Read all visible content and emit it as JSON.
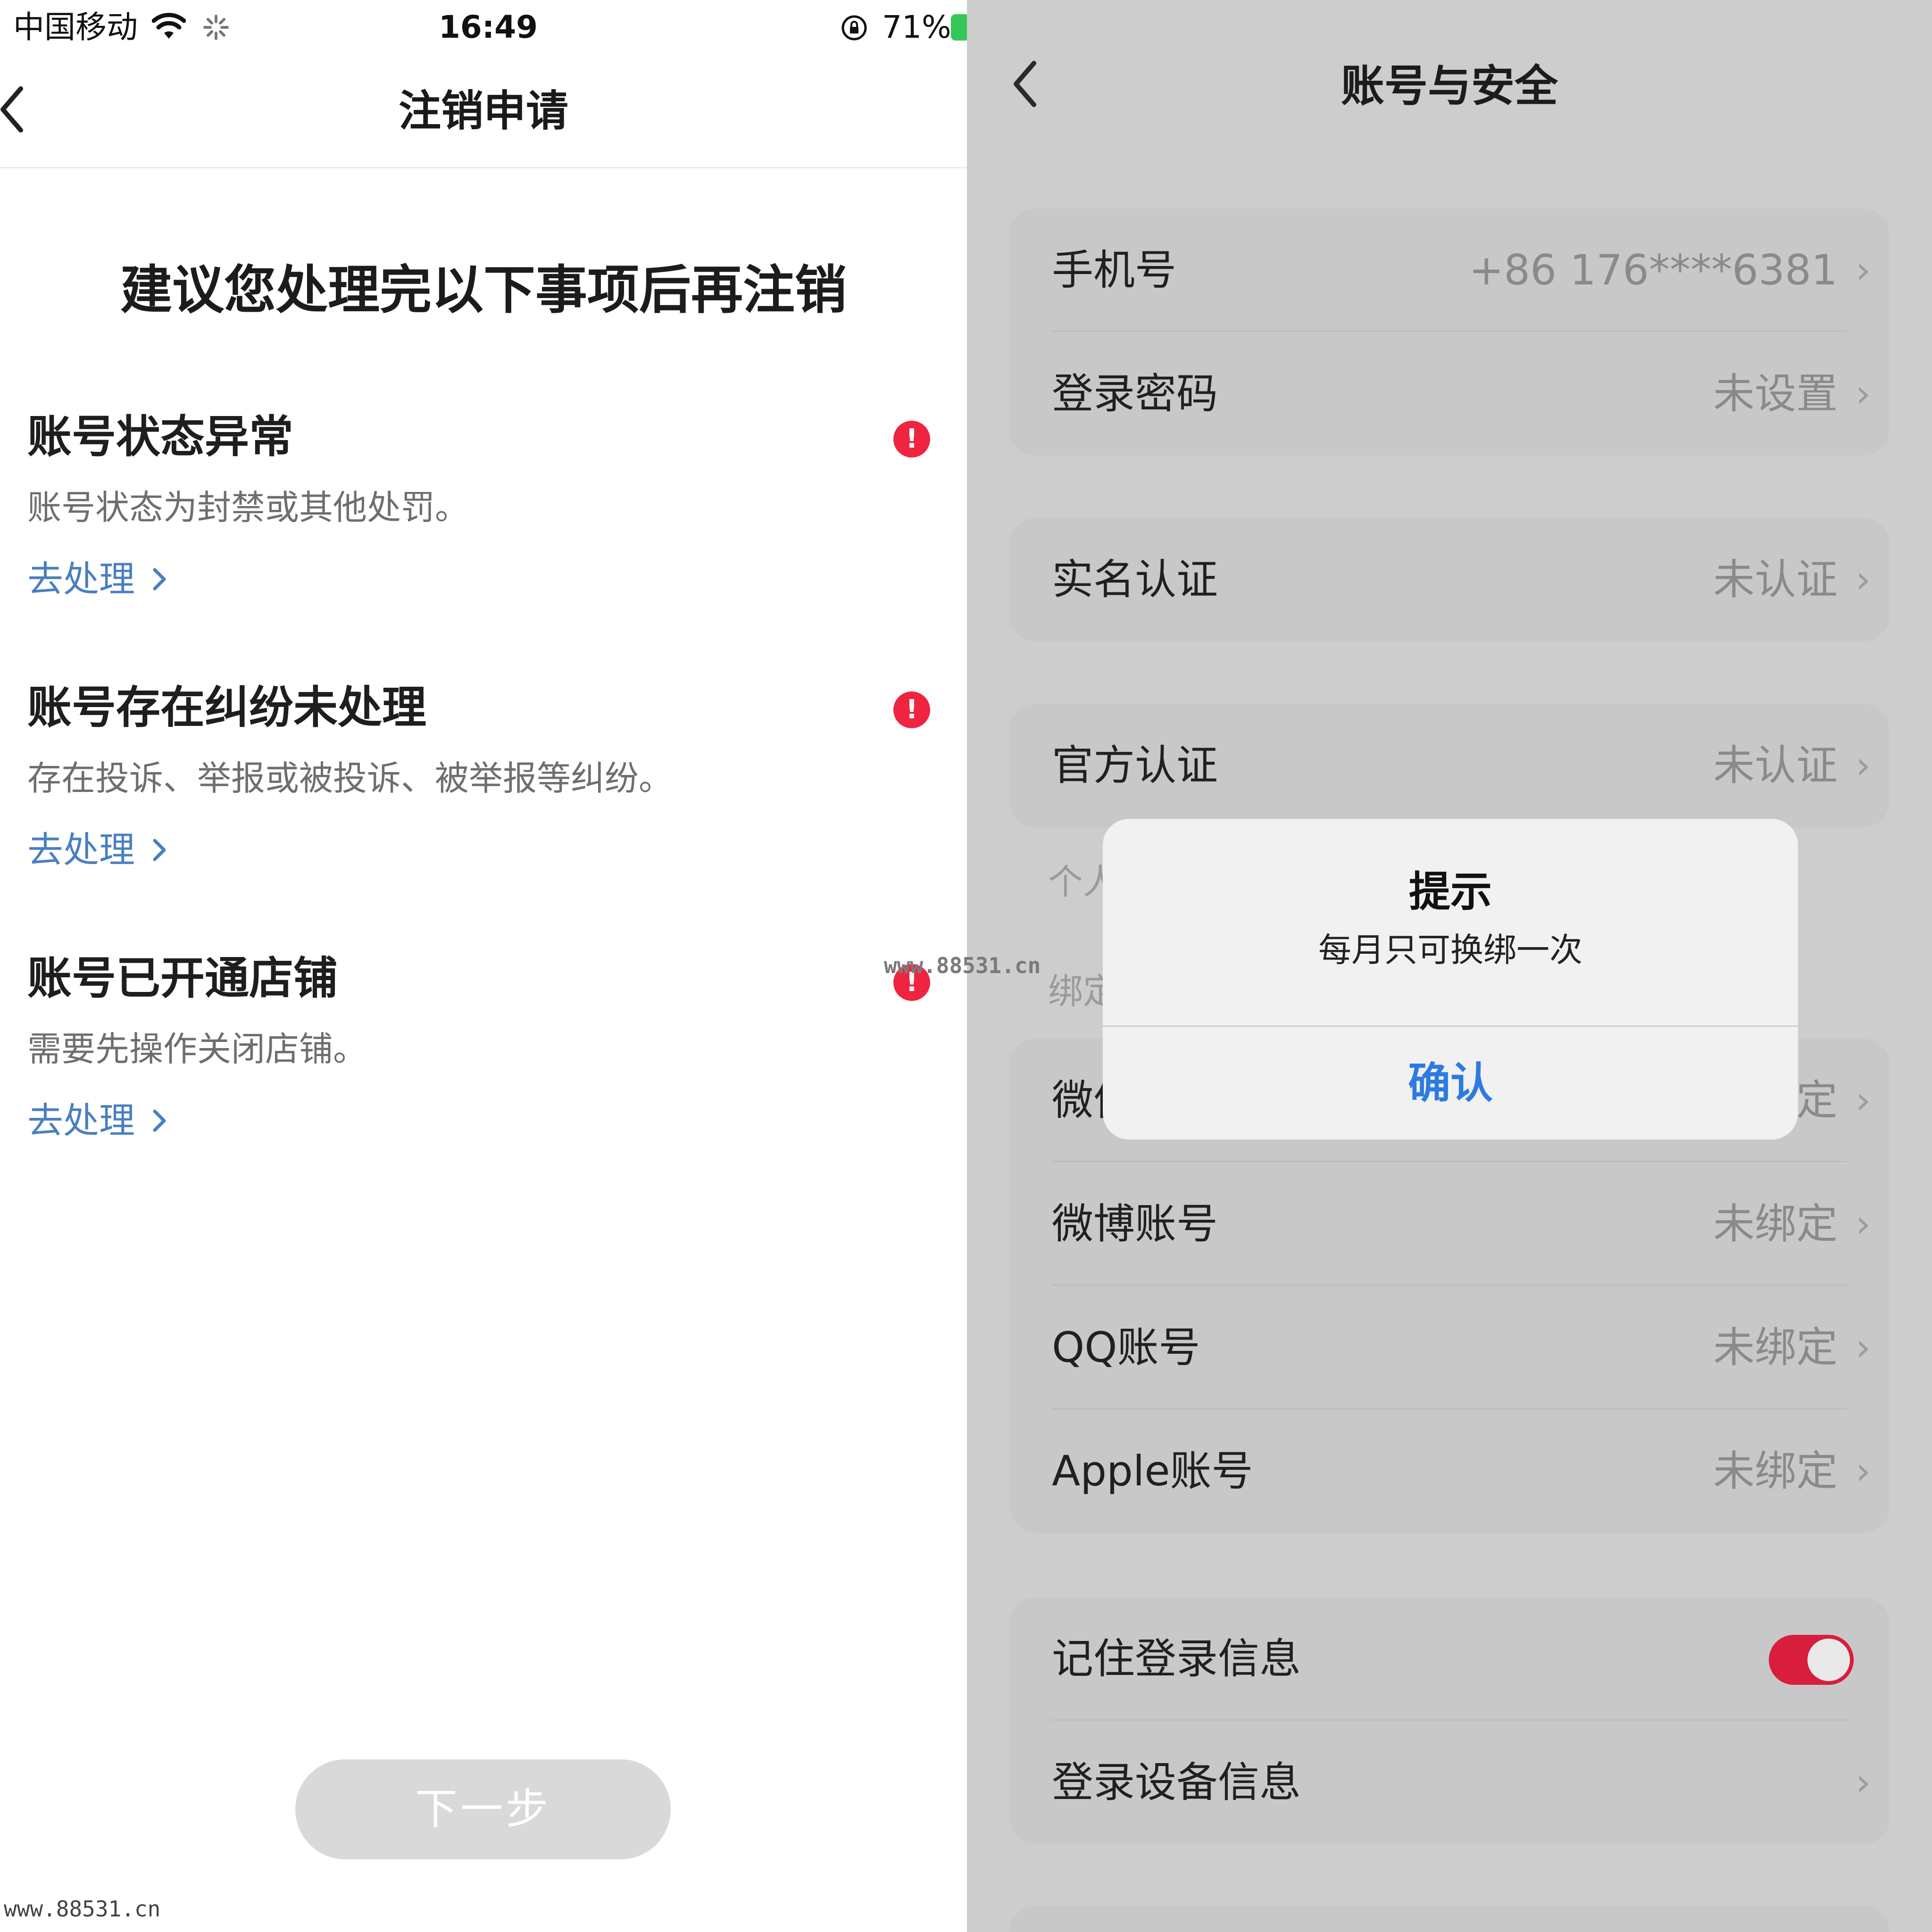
{
  "left": {
    "status": {
      "carrier": "中国移动",
      "time": "16:49",
      "battery": "71%"
    },
    "title": "注销申请",
    "headline": "建议您处理完以下事项后再注销",
    "items": [
      {
        "title": "账号状态异常",
        "desc": "账号状态为封禁或其他处罚。",
        "link": "去处理"
      },
      {
        "title": "账号存在纠纷未处理",
        "desc": "存在投诉、举报或被投诉、被举报等纠纷。",
        "link": "去处理"
      },
      {
        "title": "账号已开通店铺",
        "desc": "需要先操作关闭店铺。",
        "link": "去处理"
      }
    ],
    "alert_glyph": "!",
    "next_button": "下一步"
  },
  "right": {
    "title": "账号与安全",
    "rows": {
      "phone": {
        "label": "手机号",
        "value": "+86 176****6381"
      },
      "password": {
        "label": "登录密码",
        "value": "未设置"
      },
      "realname": {
        "label": "实名认证",
        "value": "未认证"
      },
      "official": {
        "label": "官方认证",
        "value": "未认证"
      },
      "wechat": {
        "label": "微信",
        "value": "未绑定"
      },
      "weibo": {
        "label": "微博账号",
        "value": "未绑定"
      },
      "qq": {
        "label": "QQ账号",
        "value": "未绑定"
      },
      "apple": {
        "label": "Apple账号",
        "value": "未绑定"
      },
      "remember": {
        "label": "记住登录信息",
        "toggle_on": true
      },
      "devices": {
        "label": "登录设备信息"
      }
    },
    "section_labels": {
      "personal": "个人",
      "bind": "绑定"
    },
    "chevron": "›"
  },
  "dialog": {
    "title": "提示",
    "message": "每月只可换绑一次",
    "confirm": "确认"
  },
  "watermarks": {
    "center": "www.88531.cn",
    "bottom": "www.88531.cn"
  },
  "colors": {
    "alert": "#ef2440",
    "link": "#4a7fc0",
    "confirm": "#2d7be0",
    "toggle": "#d81e3c"
  }
}
